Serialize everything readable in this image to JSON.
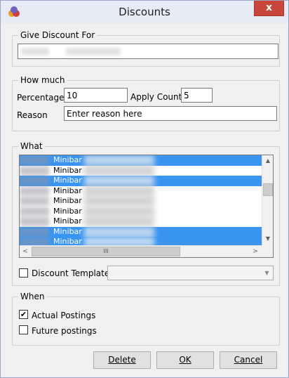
{
  "window": {
    "title": "Discounts",
    "close_label": "x",
    "app_icon": "app-logo-icon"
  },
  "give_discount": {
    "legend": "Give Discount For"
  },
  "how_much": {
    "legend": "How much",
    "percentage_label": "Percentage",
    "percentage_value": "10",
    "apply_count_label": "Apply Count",
    "apply_count_value": "5",
    "reason_label": "Reason",
    "reason_value": "Enter reason here"
  },
  "what": {
    "legend": "What",
    "items": [
      {
        "label": "Minibar",
        "selected": true
      },
      {
        "label": "Minibar",
        "selected": false
      },
      {
        "label": "Minibar",
        "selected": true
      },
      {
        "label": "Minibar",
        "selected": false
      },
      {
        "label": "Minibar",
        "selected": false
      },
      {
        "label": "Minibar",
        "selected": false
      },
      {
        "label": "Minibar",
        "selected": false
      },
      {
        "label": "Minibar",
        "selected": true
      },
      {
        "label": "Minibar",
        "selected": true
      }
    ],
    "scroll_up": "▲",
    "scroll_down": "▼",
    "scroll_left": "<",
    "scroll_right": ">",
    "thumb_grip": "III",
    "discount_template_label": "Discount Template",
    "discount_template_checked": false,
    "discount_template_value": ""
  },
  "when": {
    "legend": "When",
    "actual_postings_label": "Actual Postings",
    "actual_postings_checked": true,
    "future_postings_label": "Future postings",
    "future_postings_checked": false
  },
  "buttons": {
    "delete_label": "Delete",
    "ok_label": "OK",
    "cancel_label": "Cancel"
  },
  "colors": {
    "selection": "#3a94f2",
    "close": "#c9463d"
  }
}
